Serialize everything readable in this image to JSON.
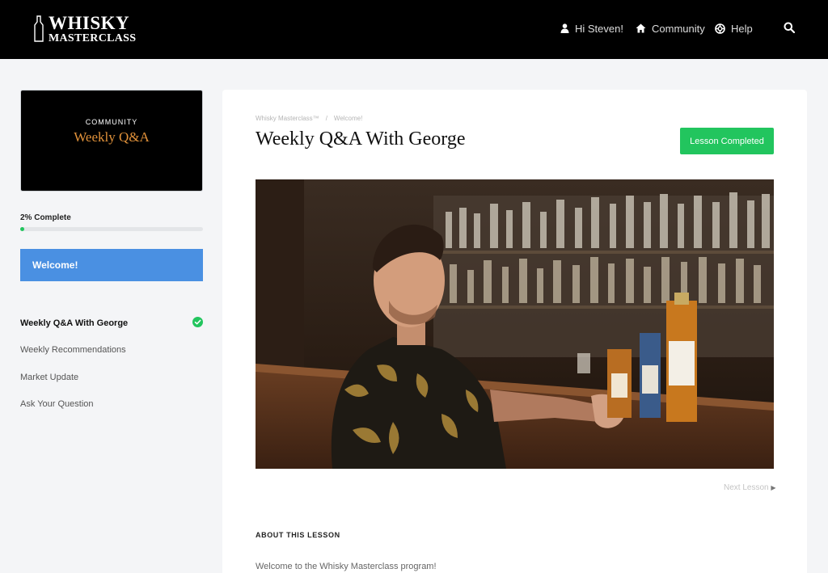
{
  "brand": {
    "line1": "WHISKY",
    "line2": "MASTERCLASS"
  },
  "nav": {
    "user": "Hi Steven!",
    "community": "Community",
    "help": "Help"
  },
  "course_card": {
    "kicker": "COMMUNITY",
    "title": "Weekly Q&A"
  },
  "progress": {
    "label": "2% Complete",
    "percent": 2
  },
  "section": {
    "label": "Welcome!"
  },
  "lessons": [
    {
      "label": "Weekly Q&A With George",
      "active": true,
      "completed": true
    },
    {
      "label": "Weekly Recommendations",
      "active": false,
      "completed": false
    },
    {
      "label": "Market Update",
      "active": false,
      "completed": false
    },
    {
      "label": "Ask Your Question",
      "active": false,
      "completed": false
    }
  ],
  "breadcrumb": {
    "root": "Whisky Masterclass™",
    "separator": "/",
    "current": "Welcome!"
  },
  "lesson": {
    "title": "Weekly Q&A With George",
    "completed_label": "Lesson Completed",
    "next_label": "Next Lesson"
  },
  "about": {
    "heading": "ABOUT THIS LESSON",
    "text": "Welcome to the Whisky Masterclass program!"
  },
  "colors": {
    "header": "#000000",
    "accent_blue": "#4a90e2",
    "accent_green": "#22c55e",
    "course_title": "#e0913a"
  }
}
